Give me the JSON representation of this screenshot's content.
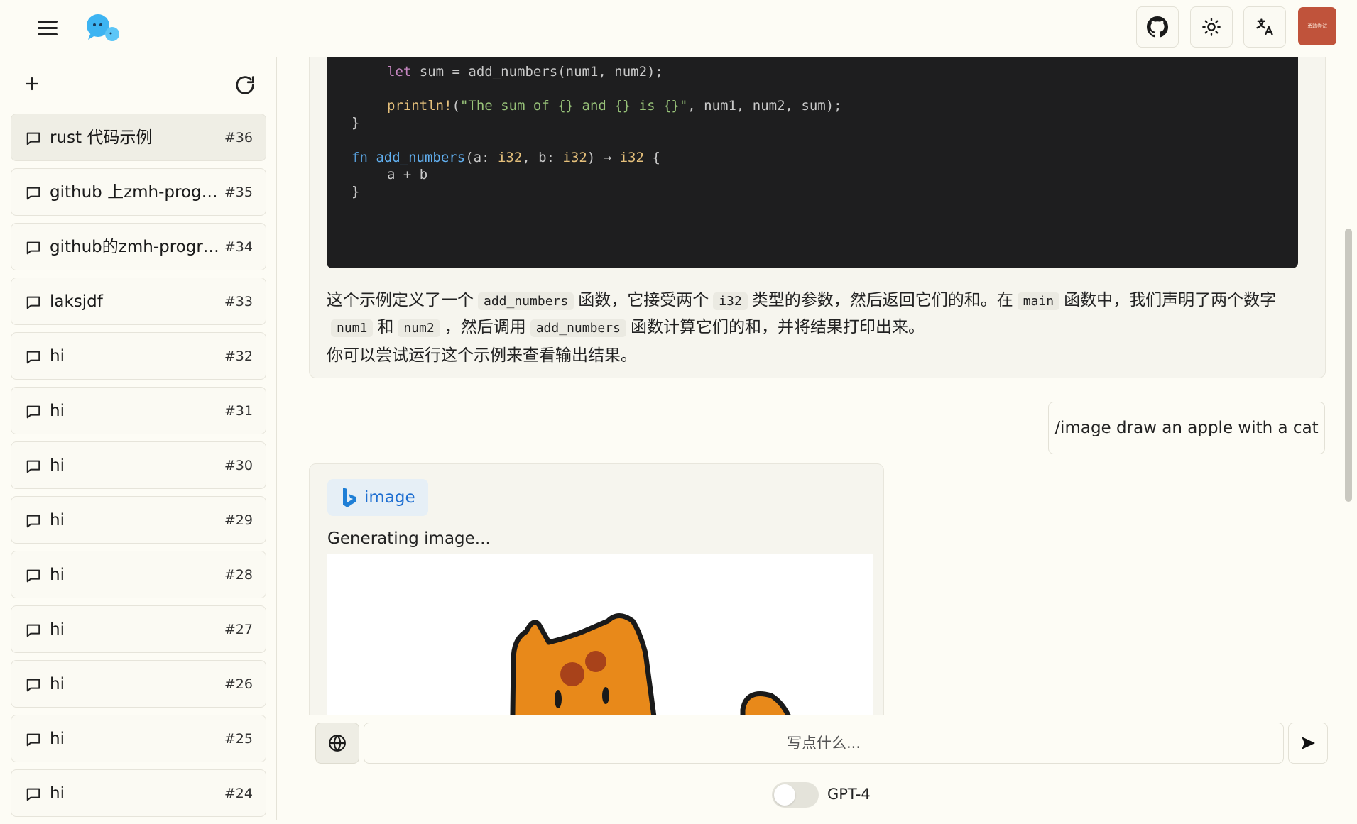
{
  "header": {
    "menu_icon": "hamburger-icon",
    "logo_icon": "chat-bubbles-logo",
    "github_icon": "github-icon",
    "theme_icon": "sun-icon",
    "translate_icon": "translate-icon",
    "avatar_text": "勇敢尝试",
    "avatar_color": "#c0533b"
  },
  "sidebar": {
    "new_chat_icon": "plus-icon",
    "refresh_icon": "refresh-icon",
    "chats": [
      {
        "title": "rust 代码示例",
        "num": "#36",
        "active": true
      },
      {
        "title": "github 上zmh-program...",
        "num": "#35"
      },
      {
        "title": "github的zmh-program...",
        "num": "#34"
      },
      {
        "title": "laksjdf",
        "num": "#33"
      },
      {
        "title": "hi",
        "num": "#32"
      },
      {
        "title": "hi",
        "num": "#31"
      },
      {
        "title": "hi",
        "num": "#30"
      },
      {
        "title": "hi",
        "num": "#29"
      },
      {
        "title": "hi",
        "num": "#28"
      },
      {
        "title": "hi",
        "num": "#27"
      },
      {
        "title": "hi",
        "num": "#26"
      },
      {
        "title": "hi",
        "num": "#25"
      },
      {
        "title": "hi",
        "num": "#24"
      }
    ]
  },
  "conversation": {
    "code": {
      "l1_kw": "let",
      "l1_rest": " sum = add_numbers(num1, num2);",
      "l2_macro": "println!",
      "l2_open": "(",
      "l2_str": "\"The sum of {} and {} is {}\"",
      "l2_rest": ", num1, num2, sum);",
      "l3": "}",
      "l4_kw": "fn",
      "l4_name": "add_numbers",
      "l4_p1": "(a: ",
      "l4_t1": "i32",
      "l4_p2": ", b: ",
      "l4_t2": "i32",
      "l4_p3": ") → ",
      "l4_t3": "i32",
      "l4_p4": " {",
      "l5": "a + b",
      "l6": "}"
    },
    "explain": {
      "t1": "这个示例定义了一个",
      "c1": "add_numbers",
      "t2": "函数，它接受两个",
      "c2": "i32",
      "t3": "类型的参数，然后返回它们的和。在",
      "c3": "main",
      "t4": "函数中，我们声明了两个数字",
      "c4": "num1",
      "t5": "和",
      "c5": "num2",
      "t6": "，然后调用",
      "c6": "add_numbers",
      "t7": "函数计算它们的和，并将结果打印出来。"
    },
    "closing": "你可以尝试运行这个示例来查看输出结果。",
    "user_message": "/image draw an apple with a cat",
    "plugin_label": "image",
    "plugin_icon": "bing-icon",
    "generating_text": "Generating image..."
  },
  "input": {
    "web_icon": "globe-icon",
    "placeholder": "写点什么...",
    "value": "",
    "send_icon": "send-icon",
    "model_label": "GPT-4",
    "gpt4_enabled": false
  }
}
